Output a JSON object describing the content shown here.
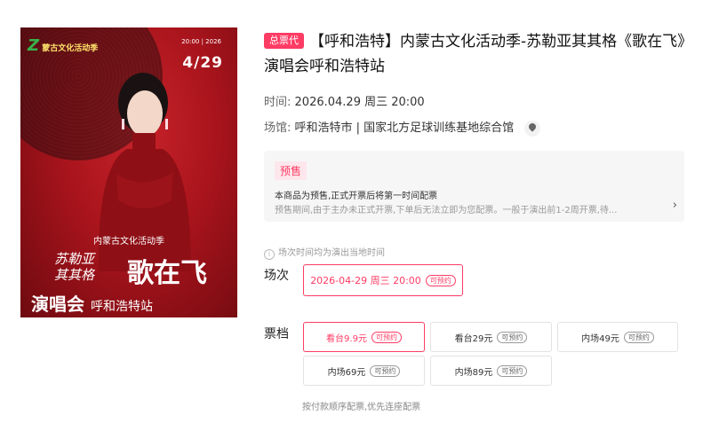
{
  "poster": {
    "logo_text": "蒙古文化活动季",
    "logo_mark": "Z",
    "date_sub": "20:00 | 2026",
    "date": "4/29",
    "caption": "内蒙古文化活动季",
    "artist_line1": "苏勒亚",
    "artist_line2": "其其格",
    "song": "歌在飞",
    "concert_main": "演唱会",
    "concert_city": "呼和浩特站"
  },
  "product": {
    "agent_badge": "总票代",
    "title": "【呼和浩特】内蒙古文化活动季-苏勒亚其其格《歌在飞》演唱会呼和浩特站"
  },
  "meta": {
    "time_label": "时间:",
    "time_value": "2026.04.29 周三 20:00",
    "venue_label": "场馆:",
    "venue_value": "呼和浩特市 | 国家北方足球训练基地综合馆"
  },
  "presale": {
    "tag": "预售",
    "line1": "本商品为预售,正式开票后将第一时间配票",
    "line2": "预售期间,由于主办未正式开票,下单后无法立即为您配票。一般于演出前1-2周开票,待...",
    "chevron": "›"
  },
  "timezone_note": {
    "icon": "i",
    "text": "场次时间均为演出当地时间"
  },
  "sessions": {
    "label": "场次",
    "items": [
      {
        "text": "2026-04-29 周三 20:00",
        "status": "可预约"
      }
    ]
  },
  "tickets": {
    "label": "票档",
    "items": [
      {
        "text": "看台9.9元",
        "status": "可预约"
      },
      {
        "text": "看台29元",
        "status": "可预约"
      },
      {
        "text": "内场49元",
        "status": "可预约"
      },
      {
        "text": "内场69元",
        "status": "可预约"
      },
      {
        "text": "内场89元",
        "status": "可预约"
      }
    ],
    "footnote": "按付款顺序配票,优先连座配票"
  },
  "colors": {
    "accent": "#ff3c64",
    "poster_red": "#a9141c"
  }
}
